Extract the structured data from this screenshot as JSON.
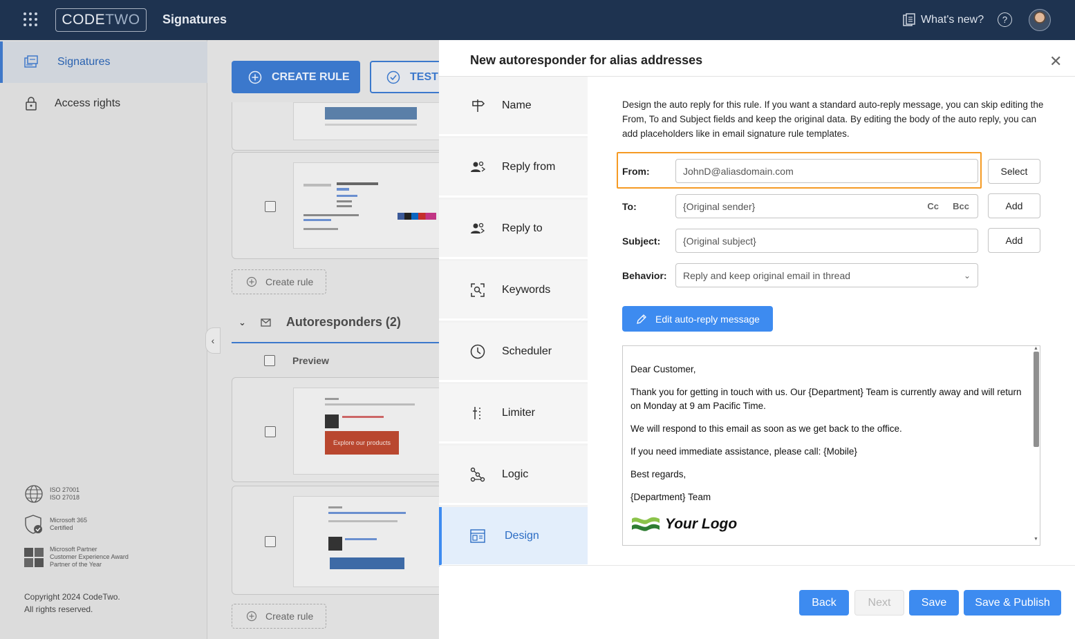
{
  "header": {
    "brand_code": "CODE",
    "brand_two": "TWO",
    "app_title": "Signatures",
    "whats_new": "What's new?",
    "help": "?"
  },
  "nav": {
    "items": [
      {
        "label": "Signatures"
      },
      {
        "label": "Access rights"
      }
    ],
    "certs": [
      {
        "line1": "ISO 27001",
        "line2": "ISO 27018",
        "line3": ""
      },
      {
        "line1": "Microsoft 365",
        "line2": "Certified",
        "line3": ""
      },
      {
        "line1": "Microsoft Partner",
        "line2": "Customer Experience Award",
        "line3": "Partner of the Year"
      }
    ],
    "copyright1": "Copyright 2024 CodeTwo.",
    "copyright2": "All rights reserved."
  },
  "background": {
    "create_rule_btn": "CREATE RULE",
    "test_btn": "TEST",
    "create_rule_link": "Create rule",
    "autoresponders_title": "Autoresponders (2)",
    "preview_header": "Preview",
    "thumb_cta": "Explore our products"
  },
  "dialog": {
    "title": "New autoresponder for alias addresses",
    "close": "✕",
    "steps": [
      {
        "label": "Name",
        "icon": "signpost-icon"
      },
      {
        "label": "Reply from",
        "icon": "users-icon"
      },
      {
        "label": "Reply to",
        "icon": "users-icon"
      },
      {
        "label": "Keywords",
        "icon": "keywords-icon"
      },
      {
        "label": "Scheduler",
        "icon": "clock-icon"
      },
      {
        "label": "Limiter",
        "icon": "limiter-icon"
      },
      {
        "label": "Logic",
        "icon": "logic-icon"
      },
      {
        "label": "Design",
        "icon": "design-icon"
      }
    ],
    "active_step": "Design",
    "description": "Design the auto reply for this rule. If you want a standard auto-reply message, you can skip editing the From, To and Subject fields and keep the original data. By editing the body of the auto reply, you can add placeholders like in email signature rule templates.",
    "from_label": "From:",
    "from_value": "JohnD@aliasdomain.com",
    "select_btn": "Select",
    "to_label": "To:",
    "to_value": "{Original sender}",
    "cc": "Cc",
    "bcc": "Bcc",
    "add_btn": "Add",
    "subject_label": "Subject:",
    "subject_value": "{Original subject}",
    "behavior_label": "Behavior:",
    "behavior_value": "Reply and keep original email in thread",
    "edit_btn": "Edit auto-reply message",
    "message": {
      "greeting": "Dear Customer,",
      "p1": "Thank you for getting in touch with us. Our {Department} Team is currently away and will return on Monday at 9 am Pacific Time.",
      "p2": "We will respond to this email as soon as we get back to the office.",
      "p3": "If you need immediate assistance, please call: {Mobile}",
      "closing": "Best regards,",
      "signoff": "{Department} Team",
      "logo_text": "Your Logo"
    },
    "footer": {
      "back": "Back",
      "next": "Next",
      "save": "Save",
      "save_publish": "Save & Publish"
    }
  },
  "colors": {
    "topbar": "#1e3350",
    "accent": "#3d8bf0",
    "highlight": "#f59a23"
  }
}
